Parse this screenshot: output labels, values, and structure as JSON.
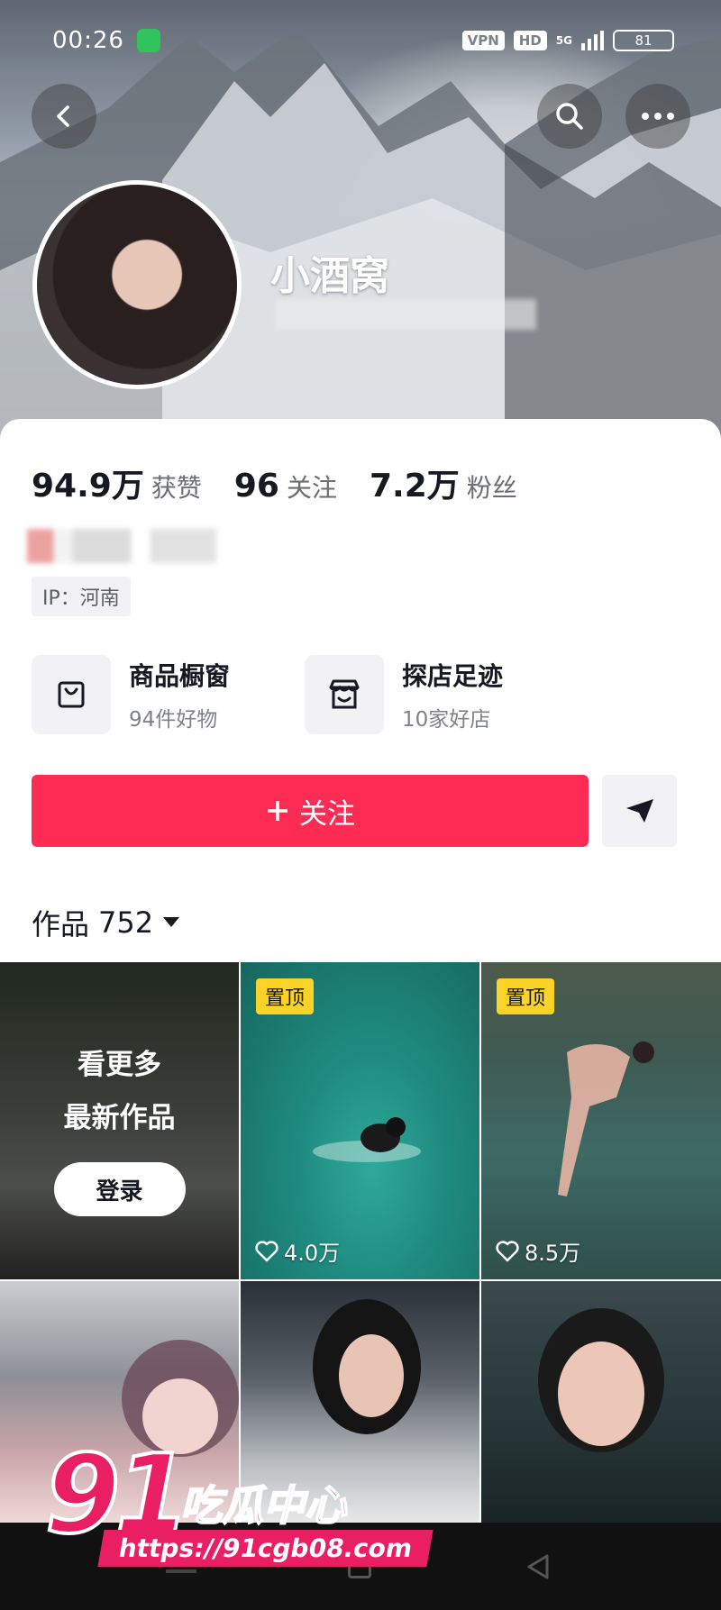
{
  "status_bar": {
    "time": "00:26",
    "vpn": "VPN",
    "hd": "HD",
    "net": "5G",
    "battery": "81"
  },
  "profile": {
    "username": "小酒窝",
    "stats": [
      {
        "value": "94.9万",
        "label": "获赞"
      },
      {
        "value": "96",
        "label": "关注"
      },
      {
        "value": "7.2万",
        "label": "粉丝"
      }
    ],
    "ip": "IP：河南"
  },
  "features": [
    {
      "title": "商品橱窗",
      "subtitle": "94件好物",
      "icon": "shopping-bag-icon"
    },
    {
      "title": "探店足迹",
      "subtitle": "10家好店",
      "icon": "store-icon"
    }
  ],
  "actions": {
    "follow_label": "关注"
  },
  "works": {
    "label": "作品",
    "count": "752"
  },
  "grid": {
    "login_line1": "看更多",
    "login_line2": "最新作品",
    "login_button": "登录",
    "pin_label": "置顶",
    "tiles": [
      {
        "likes": "4.0万"
      },
      {
        "likes": "8.5万"
      }
    ]
  },
  "watermark": {
    "number": "91",
    "brand": "吃瓜中心",
    "url": "https://91cgb08.com"
  },
  "colors": {
    "accent": "#fe2c55",
    "pin": "#fbd228",
    "watermark": "#e91e63"
  }
}
